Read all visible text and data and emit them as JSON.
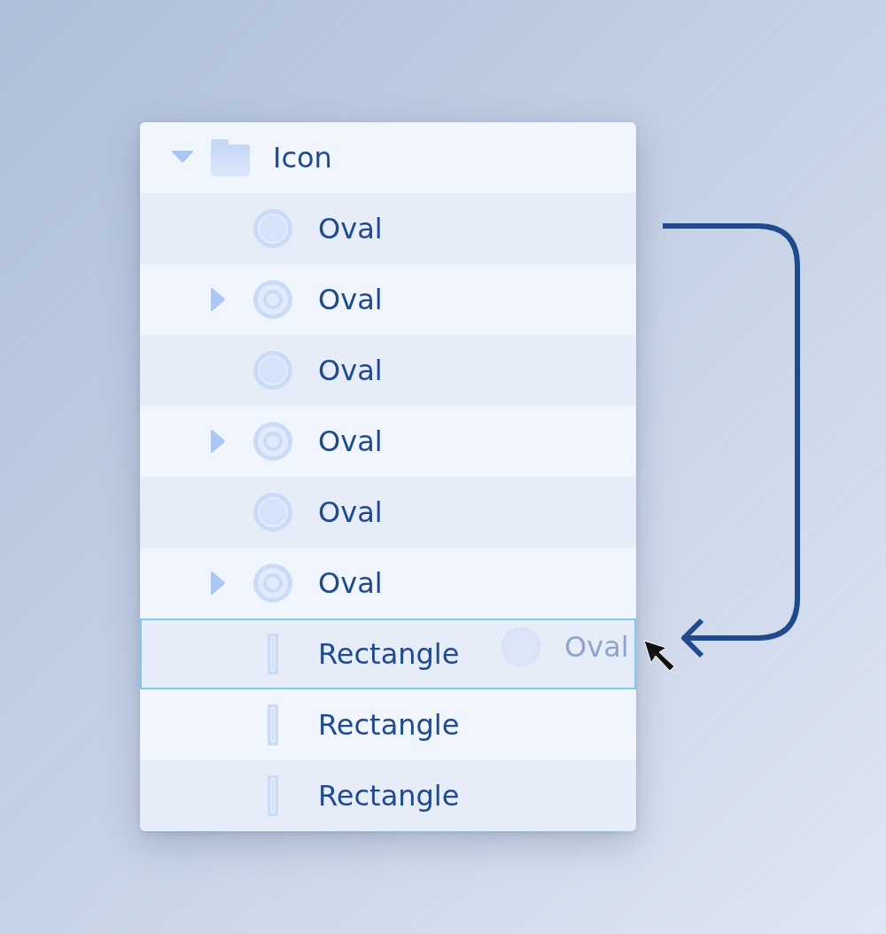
{
  "layer_tree": {
    "name": "Icon",
    "kind": "folder",
    "has_children": true,
    "expanded": true,
    "selected": false,
    "children": [
      {
        "name": "Oval",
        "kind": "oval",
        "has_children": false,
        "selected": false
      },
      {
        "name": "Oval",
        "kind": "oval-nested",
        "has_children": true,
        "expanded": false,
        "selected": false
      },
      {
        "name": "Oval",
        "kind": "oval",
        "has_children": false,
        "selected": false
      },
      {
        "name": "Oval",
        "kind": "oval-nested",
        "has_children": true,
        "expanded": false,
        "selected": false
      },
      {
        "name": "Oval",
        "kind": "oval",
        "has_children": false,
        "selected": false
      },
      {
        "name": "Oval",
        "kind": "oval-nested",
        "has_children": true,
        "expanded": false,
        "selected": false
      },
      {
        "name": "Rectangle",
        "kind": "rectangle",
        "has_children": false,
        "selected": true
      },
      {
        "name": "Rectangle",
        "kind": "rectangle",
        "has_children": false,
        "selected": false
      },
      {
        "name": "Rectangle",
        "kind": "rectangle",
        "has_children": false,
        "selected": false
      }
    ]
  },
  "drag_preview": {
    "name": "Oval",
    "kind": "oval"
  }
}
